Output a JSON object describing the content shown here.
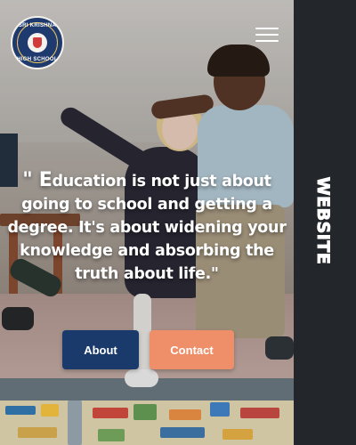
{
  "header": {
    "logo": {
      "text_top": "SRI KRISHNA",
      "text_bottom": "HIGH SCHOOL"
    },
    "menu_icon": "hamburger-icon"
  },
  "hero": {
    "quote_first_letter": "\" E",
    "quote_rest": "ducation is not just about going to school and getting a degree. It's about widening your knowledge and absorbing the truth about life.\""
  },
  "actions": {
    "about_label": "About",
    "contact_label": "Contact"
  },
  "sidebar": {
    "label": "WEBSITE"
  },
  "colors": {
    "primary_button": "#1a3a6b",
    "secondary_button": "#ef8f6a",
    "sidebar_bg": "#23272c",
    "text_light": "#ffffff"
  }
}
